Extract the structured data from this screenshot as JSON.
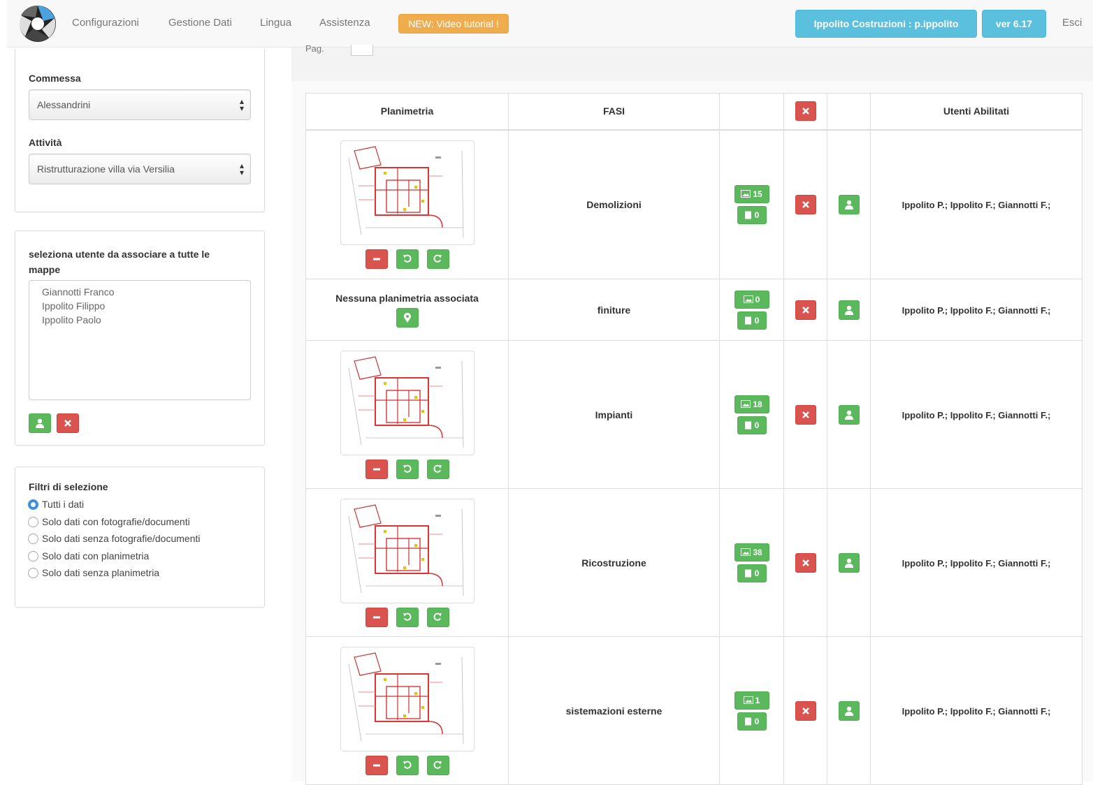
{
  "navbar": {
    "links": [
      "Configurazioni",
      "Gestione Dati",
      "Lingua",
      "Assistenza"
    ],
    "badge": "NEW: Video tutorial !",
    "user_button": "Ippolito Costruzioni : p.ippolito",
    "version_button": "ver 6.17",
    "logout": "Esci"
  },
  "sidebar": {
    "commessa_label": "Commessa",
    "commessa_value": "Alessandrini",
    "attivita_label": "Attività",
    "attivita_value": "Ristrutturazione villa via Versilia",
    "users_label": "seleziona utente da associare a tutte le mappe",
    "users": [
      "Giannotti Franco",
      "Ippolito Filippo",
      "Ippolito Paolo"
    ],
    "filters_label": "Filtri di selezione",
    "filters": [
      {
        "label": "Tutti i dati",
        "selected": true
      },
      {
        "label": "Solo dati con fotografie/documenti",
        "selected": false
      },
      {
        "label": "Solo dati senza fotografie/documenti",
        "selected": false
      },
      {
        "label": "Solo dati con planimetria",
        "selected": false
      },
      {
        "label": "Solo dati senza planimetria",
        "selected": false
      }
    ]
  },
  "main": {
    "columns": [
      "Planimetria",
      "FASI",
      "",
      "",
      "",
      "Utenti Abilitati"
    ],
    "no_plan_text": "Nessuna planimetria associata",
    "rows": [
      {
        "fase": "Demolizioni",
        "photos": "15",
        "docs": "0",
        "users": "Ippolito P.; Ippolito F.; Giannotti F.;",
        "has_plan": true
      },
      {
        "fase": "finiture",
        "photos": "0",
        "docs": "0",
        "users": "Ippolito P.; Ippolito F.; Giannotti F.;",
        "has_plan": false
      },
      {
        "fase": "Impianti",
        "photos": "18",
        "docs": "0",
        "users": "Ippolito P.; Ippolito F.; Giannotti F.;",
        "has_plan": true
      },
      {
        "fase": "Ricostruzione",
        "photos": "38",
        "docs": "0",
        "users": "Ippolito P.; Ippolito F.; Giannotti F.;",
        "has_plan": true
      },
      {
        "fase": "sistemazioni esterne",
        "photos": "1",
        "docs": "0",
        "users": "Ippolito P.; Ippolito F.; Giannotti F.;",
        "has_plan": true
      }
    ]
  },
  "colors": {
    "green": "#5cb85c",
    "red": "#d9534f",
    "info": "#5bc0de",
    "warning": "#f0ad4e",
    "radio": "#3a8fe0"
  },
  "icons": {
    "photo": "image-icon",
    "doc": "document-icon",
    "delete": "close-icon",
    "user": "user-icon",
    "minus": "minus-icon",
    "rotate_left": "rotate-left-icon",
    "rotate_right": "rotate-right-icon",
    "map": "map-marker-icon"
  }
}
